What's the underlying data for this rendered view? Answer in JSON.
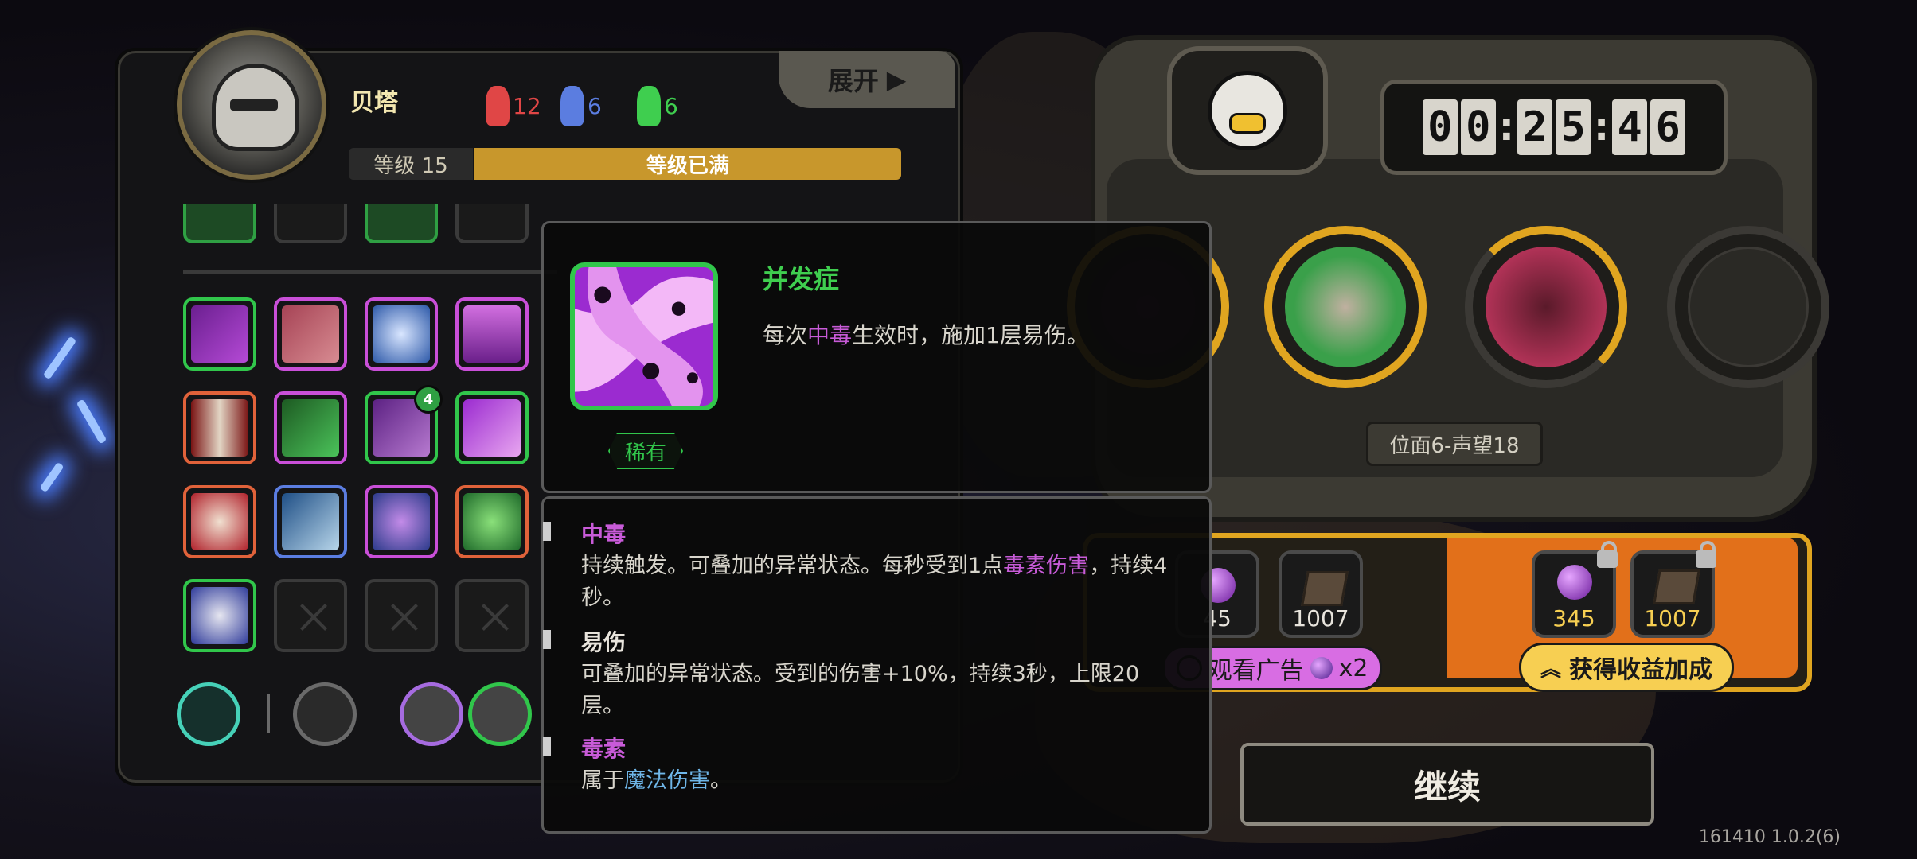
{
  "character": {
    "name": "贝塔",
    "stats": [
      {
        "icon": "red-mask-icon",
        "value": "12",
        "color": "#e04646"
      },
      {
        "icon": "blue-mask-icon",
        "value": "6",
        "color": "#5b7de0"
      },
      {
        "icon": "green-mask-icon",
        "value": "6",
        "color": "#3fce4f"
      }
    ],
    "level_label": "等级 15",
    "level_status": "等级已满",
    "expand_label": "展开"
  },
  "skills": {
    "upgrade_badge": "4"
  },
  "tooltip": {
    "title": "并发症",
    "description_parts": [
      "每次",
      "中毒",
      "生效时，施加1层易伤。"
    ],
    "rarity": "稀有",
    "keywords": [
      {
        "name": "中毒",
        "desc_parts": [
          "持续触发。可叠加的异常状态。每秒受到1点",
          "毒素伤害",
          "，持续4秒。"
        ]
      },
      {
        "name": "易伤",
        "desc": "可叠加的异常状态。受到的伤害+10%，持续3秒，上限20层。"
      },
      {
        "name": "毒素",
        "desc_parts": [
          "属于",
          "魔法伤害",
          "。"
        ]
      }
    ]
  },
  "machine": {
    "timer_digits": [
      "0",
      "0",
      "2",
      "5",
      "4",
      "6"
    ],
    "timer_separator": ":",
    "plane_label": "位面6-声望18"
  },
  "rewards": {
    "free_items": [
      {
        "icon": "purple-orb-icon",
        "count": "45"
      },
      {
        "icon": "book-icon",
        "count": "1007"
      }
    ],
    "bonus_items": [
      {
        "icon": "purple-orb-icon",
        "count": "345"
      },
      {
        "icon": "book-icon",
        "count": "1007"
      }
    ],
    "ad_label": "观看广告",
    "ad_multiplier": "x2",
    "bonus_label": "获得收益加成"
  },
  "continue_label": "继续",
  "version": "161410 1.0.2(6)"
}
